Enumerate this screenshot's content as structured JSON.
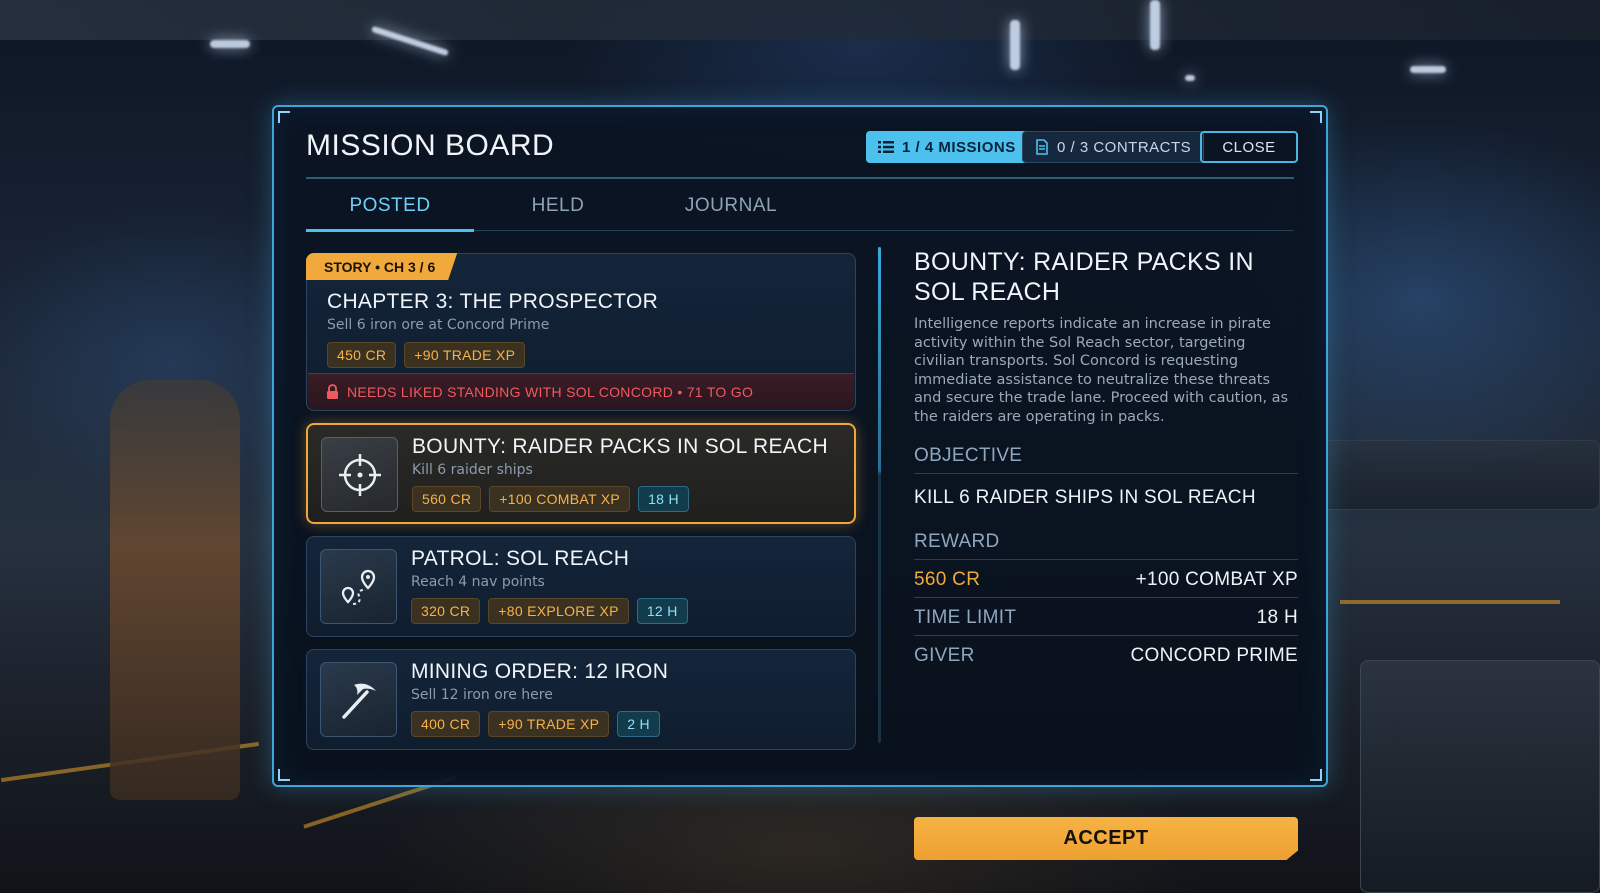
{
  "header": {
    "title": "MISSION BOARD",
    "missions_count": "1 / 4 MISSIONS",
    "contracts_count": "0 / 3 CONTRACTS",
    "close_label": "CLOSE"
  },
  "tabs": [
    {
      "label": "POSTED",
      "active": true
    },
    {
      "label": "HELD",
      "active": false
    },
    {
      "label": "JOURNAL",
      "active": false
    }
  ],
  "missions": {
    "story": {
      "tag": "STORY • CH 3 / 6",
      "title": "CHAPTER 3: THE PROSPECTOR",
      "subtitle": "Sell 6 iron ore at Concord Prime",
      "credits": "450 CR",
      "xp": "+90 TRADE XP",
      "lock_text": "NEEDS LIKED STANDING WITH SOL CONCORD • 71 TO GO"
    },
    "items": [
      {
        "icon": "crosshair-icon",
        "title": "BOUNTY: RAIDER PACKS IN SOL REACH",
        "subtitle": "Kill 6 raider ships",
        "credits": "560 CR",
        "xp": "+100 COMBAT XP",
        "time": "18 H",
        "selected": true
      },
      {
        "icon": "route-pin-icon",
        "title": "PATROL: SOL REACH",
        "subtitle": "Reach 4 nav points",
        "credits": "320 CR",
        "xp": "+80 EXPLORE XP",
        "time": "12 H",
        "selected": false
      },
      {
        "icon": "pickaxe-icon",
        "title": "MINING ORDER: 12 IRON",
        "subtitle": "Sell 12 iron ore here",
        "credits": "400 CR",
        "xp": "+90 TRADE XP",
        "time": "2 H",
        "selected": false
      }
    ]
  },
  "detail": {
    "title": "BOUNTY: RAIDER PACKS IN SOL REACH",
    "description": "Intelligence reports indicate an increase in pirate activity within the Sol Reach sector, targeting civilian transports. Sol Concord is requesting immediate assistance to neutralize these threats and secure the trade lane. Proceed with caution, as the raiders are operating in packs.",
    "objective_label": "OBJECTIVE",
    "objective": "KILL 6 RAIDER SHIPS IN SOL REACH",
    "reward_label": "REWARD",
    "reward_credits": "560 CR",
    "reward_xp": "+100 COMBAT XP",
    "time_limit_label": "TIME LIMIT",
    "time_limit": "18 H",
    "giver_label": "GIVER",
    "giver": "CONCORD PRIME",
    "accept_label": "ACCEPT"
  },
  "colors": {
    "accent": "#4cc1ee",
    "gold": "#f2a93b",
    "warning": "#f05a5e"
  }
}
